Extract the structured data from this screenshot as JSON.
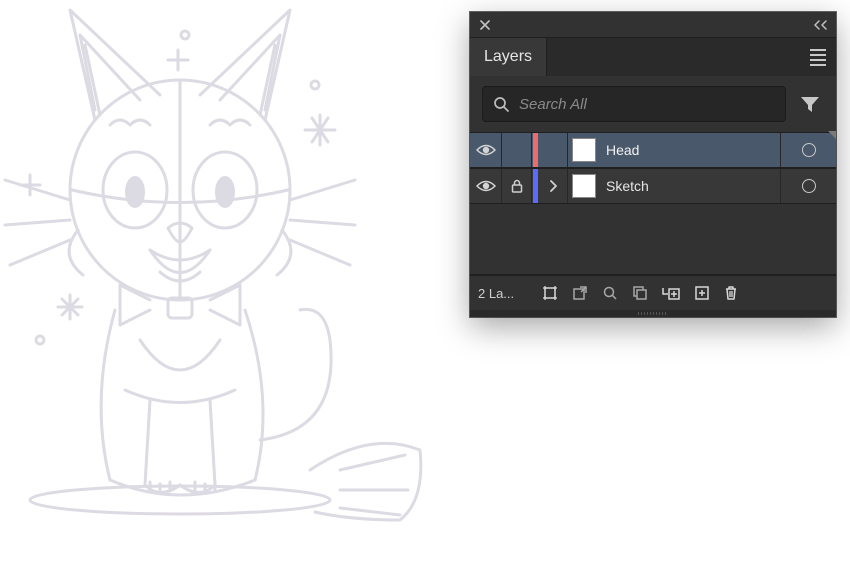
{
  "panel": {
    "title": "Layers",
    "search_placeholder": "Search All",
    "footer_count": "2 La...",
    "layers": [
      {
        "name": "Head",
        "color": "#ef6b6b",
        "selected": true,
        "locked": false,
        "expandable": false
      },
      {
        "name": "Sketch",
        "color": "#5b6bff",
        "selected": false,
        "locked": true,
        "expandable": true
      }
    ]
  }
}
